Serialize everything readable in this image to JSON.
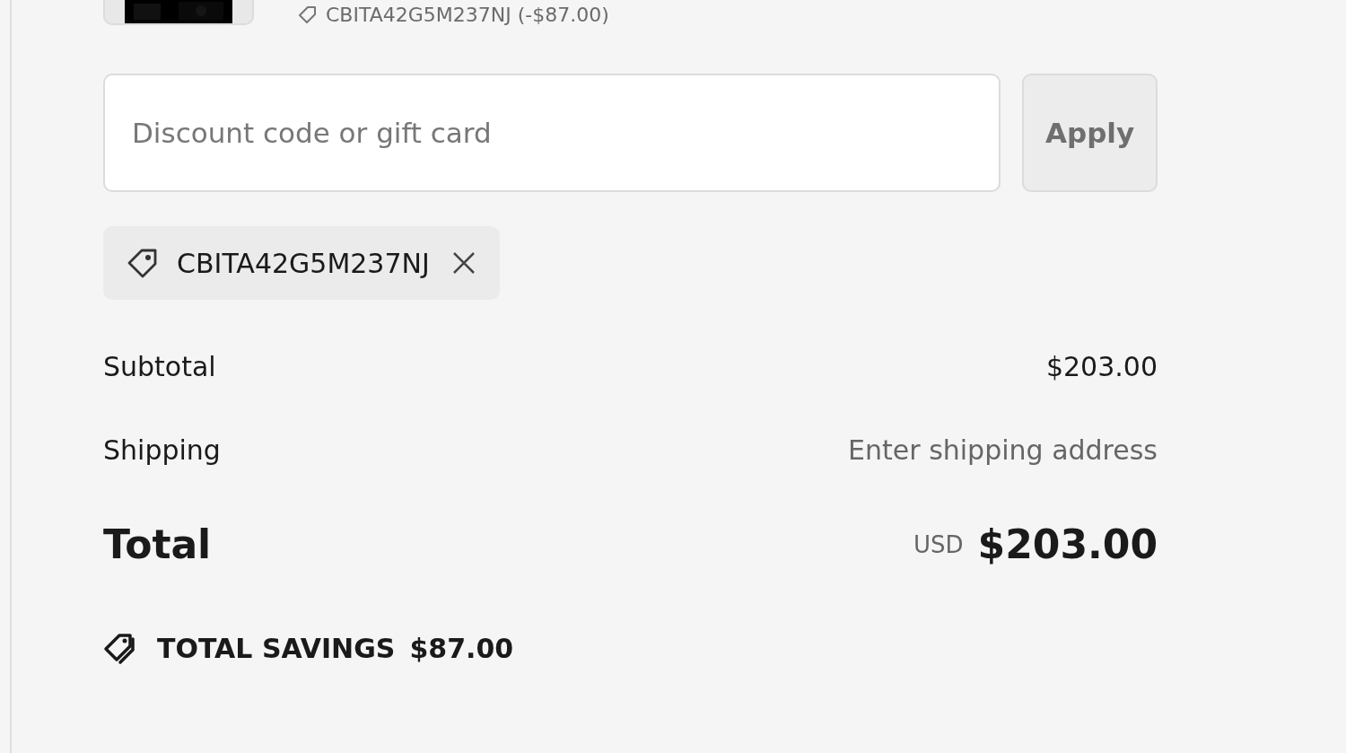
{
  "line_item": {
    "discount_label": "CBITA42G5M237NJ (-$87.00)"
  },
  "discount_field": {
    "placeholder": "Discount code or gift card"
  },
  "apply_button": {
    "label": "Apply",
    "disabled": true
  },
  "applied_codes": [
    {
      "code": "CBITA42G5M237NJ"
    }
  ],
  "summary": [
    {
      "label": "Subtotal",
      "value": "$203.00",
      "kind": "amount"
    },
    {
      "label": "Shipping",
      "value": "Enter shipping address",
      "kind": "hint"
    }
  ],
  "total": {
    "label": "Total",
    "currency": "USD",
    "value": "$203.00"
  },
  "savings": {
    "label": "TOTAL SAVINGS",
    "value": "$87.00"
  }
}
